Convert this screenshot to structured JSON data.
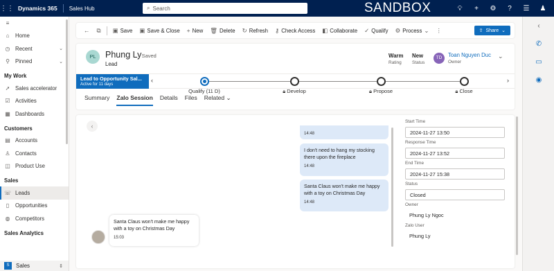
{
  "topbar": {
    "brand": "Dynamics 365",
    "app": "Sales Hub",
    "search_placeholder": "Search",
    "environment": "SANDBOX",
    "icons": [
      "lightbulb-icon",
      "plus-icon",
      "gear-icon",
      "help-icon",
      "chat-icon",
      "user-icon"
    ]
  },
  "sidebar": {
    "top_items": [
      {
        "label": "Home",
        "icon": "home-icon"
      },
      {
        "label": "Recent",
        "icon": "clock-icon"
      },
      {
        "label": "Pinned",
        "icon": "pin-icon"
      }
    ],
    "sections": [
      {
        "title": "My Work",
        "items": [
          "Sales accelerator",
          "Activities",
          "Dashboards"
        ]
      },
      {
        "title": "Customers",
        "items": [
          "Accounts",
          "Contacts",
          "Product Use"
        ]
      },
      {
        "title": "Sales",
        "items": [
          "Leads",
          "Opportunities",
          "Competitors"
        ]
      },
      {
        "title": "Sales Analytics",
        "items": []
      }
    ],
    "active_item": "Leads",
    "area_switcher": {
      "badge": "S",
      "label": "Sales"
    }
  },
  "commandbar": {
    "items": [
      "Save",
      "Save & Close",
      "New",
      "Delete",
      "Refresh",
      "Check Access",
      "Collaborate",
      "Qualify",
      "Process"
    ],
    "share_label": "Share"
  },
  "record": {
    "initials": "PL",
    "name": "Phung Ly",
    "saved_status": "- Saved",
    "entity": "Lead",
    "rating_value": "Warm",
    "rating_label": "Rating",
    "status_value": "New",
    "status_label": "Status",
    "owner_initials": "TD",
    "owner_name": "Toan Nguyen Duc",
    "owner_label": "Owner"
  },
  "bpf": {
    "process_name": "Lead to Opportunity Sal...",
    "active_for": "Active for 11 days",
    "stages": [
      {
        "label": "Qualify  (11 D)",
        "active": true,
        "locked": false
      },
      {
        "label": "Develop",
        "active": false,
        "locked": true
      },
      {
        "label": "Propose",
        "active": false,
        "locked": true
      },
      {
        "label": "Close",
        "active": false,
        "locked": true
      }
    ]
  },
  "tabs": [
    "Summary",
    "Zalo Session",
    "Details",
    "Files",
    "Related"
  ],
  "active_tab": "Zalo Session",
  "chat": {
    "messages": [
      {
        "direction": "out",
        "text": "",
        "time": "14:48"
      },
      {
        "direction": "out",
        "text": "I don't need to hang my stocking there upon the fireplace",
        "time": "14:48"
      },
      {
        "direction": "out",
        "text": "Santa Claus won't make me happy with a toy on Christmas Day",
        "time": "14:48"
      },
      {
        "direction": "in",
        "text": "Santa Claus won't make me happy with a toy on Christmas Day",
        "time": "15:03"
      }
    ]
  },
  "session_fields": [
    {
      "label": "Start Time",
      "value": "2024-11-27 13:50",
      "boxed": true
    },
    {
      "label": "Response Time",
      "value": "2024-11-27 13:52",
      "boxed": true
    },
    {
      "label": "End Time",
      "value": "2024-11-27 15:38",
      "boxed": true
    },
    {
      "label": "Status",
      "value": "Closed",
      "boxed": true
    },
    {
      "label": "Owner",
      "value": "Phung Ly Ngoc",
      "boxed": false
    },
    {
      "label": "Zalo User",
      "value": "Phung Ly",
      "boxed": false
    }
  ],
  "colors": {
    "topbar": "#002050",
    "accent": "#0f6cbd",
    "out_bubble": "#dde9f8"
  }
}
